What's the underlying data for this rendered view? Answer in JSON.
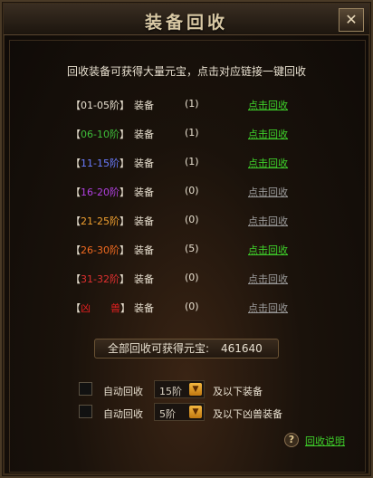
{
  "window": {
    "title": "装备回收",
    "close_glyph": "✕"
  },
  "intro": "回收装备可获得大量元宝，点击对应链接一键回收",
  "rows": [
    {
      "open": "【",
      "tier": "01-05阶",
      "close": "】",
      "color": "#e8e0d0",
      "label": "装备",
      "count": "(1)",
      "action": "点击回收",
      "active": true
    },
    {
      "open": "【",
      "tier": "06-10阶",
      "close": "】",
      "color": "#3fbf3a",
      "label": "装备",
      "count": "(1)",
      "action": "点击回收",
      "active": true
    },
    {
      "open": "【",
      "tier": "11-15阶",
      "close": "】",
      "color": "#6a7cff",
      "label": "装备",
      "count": "(1)",
      "action": "点击回收",
      "active": true
    },
    {
      "open": "【",
      "tier": "16-20阶",
      "close": "】",
      "color": "#b040e0",
      "label": "装备",
      "count": "(0)",
      "action": "点击回收",
      "active": false
    },
    {
      "open": "【",
      "tier": "21-25阶",
      "close": "】",
      "color": "#f0a030",
      "label": "装备",
      "count": "(0)",
      "action": "点击回收",
      "active": false
    },
    {
      "open": "【",
      "tier": "26-30阶",
      "close": "】",
      "color": "#f06a20",
      "label": "装备",
      "count": "(5)",
      "action": "点击回收",
      "active": true
    },
    {
      "open": "【",
      "tier": "31-32阶",
      "close": "】",
      "color": "#e03030",
      "label": "装备",
      "count": "(0)",
      "action": "点击回收",
      "active": false
    },
    {
      "open": "【",
      "tier": "凶　　兽",
      "close": "】",
      "color": "#e02020",
      "label": "装备",
      "count": "(0)",
      "action": "点击回收",
      "active": false
    }
  ],
  "total": {
    "label": "全部回收可获得元宝:",
    "value": "461640"
  },
  "options": [
    {
      "label": "自动回收",
      "select_value": "15阶",
      "suffix": "及以下装备",
      "checked": false
    },
    {
      "label": "自动回收",
      "select_value": "5阶",
      "suffix": "及以下凶兽装备",
      "checked": false
    }
  ],
  "help": {
    "icon_glyph": "?",
    "link": "回收说明"
  },
  "colors": {
    "link_active": "#3ecf2a",
    "link_inactive": "#9a9a9a"
  }
}
